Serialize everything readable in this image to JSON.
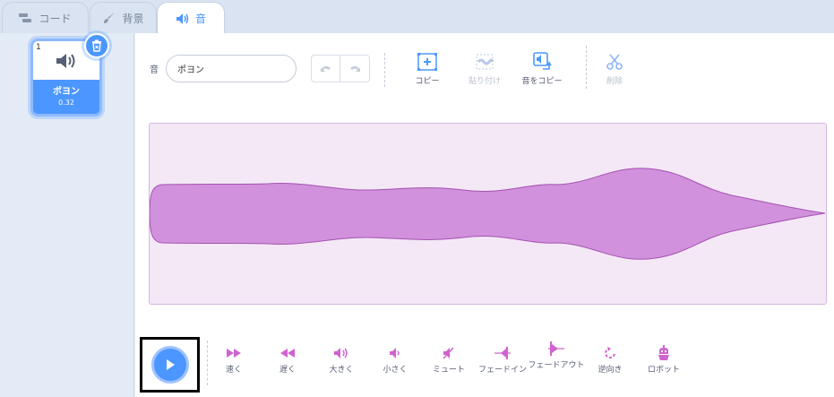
{
  "tabs": [
    {
      "label": "コード",
      "icon": "code-icon"
    },
    {
      "label": "背景",
      "icon": "brush-icon"
    },
    {
      "label": "音",
      "icon": "speaker-icon"
    }
  ],
  "sound_list": {
    "items": [
      {
        "index": "1",
        "name": "ポヨン",
        "duration": "0.32"
      }
    ]
  },
  "editor": {
    "name_label": "音",
    "name_value": "ポヨン",
    "tools": {
      "copy": "コピー",
      "paste": "貼り付け",
      "copy_to_new": "音をコピー",
      "delete": "削除"
    }
  },
  "effects": [
    {
      "label": "速く",
      "icon": "faster-icon"
    },
    {
      "label": "遅く",
      "icon": "slower-icon"
    },
    {
      "label": "大きく",
      "icon": "louder-icon"
    },
    {
      "label": "小さく",
      "icon": "softer-icon"
    },
    {
      "label": "ミュート",
      "icon": "mute-icon"
    },
    {
      "label": "フェードイン",
      "icon": "fade-in-icon"
    },
    {
      "label": "フェードアウト",
      "icon": "fade-out-icon"
    },
    {
      "label": "逆向き",
      "icon": "reverse-icon"
    },
    {
      "label": "ロボット",
      "icon": "robot-icon"
    }
  ],
  "colors": {
    "accent": "#4c97ff",
    "sound_purple": "#cf63cf",
    "wave_fill": "#d191dc",
    "wave_bg": "#f4e8f7"
  }
}
